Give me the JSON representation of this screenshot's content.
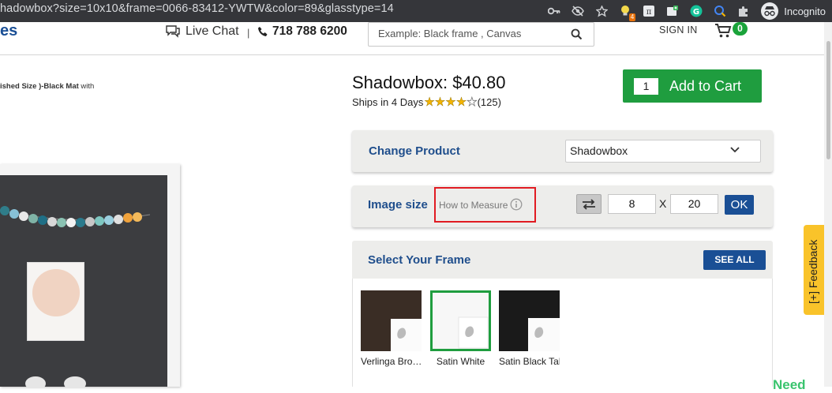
{
  "browser": {
    "url": "hadowbox?size=10x10&frame=0066-83412-YWTW&color=89&glasstype=14",
    "extension_badge": "4",
    "incognito_label": "Incognito"
  },
  "header": {
    "logo_fragment": "es",
    "live_chat": "Live Chat",
    "separator": "|",
    "phone": "718 788 6200",
    "search_placeholder": "Example: Black frame , Canvas",
    "sign_in": "SIGN IN",
    "cart_count": "0"
  },
  "image_caption": {
    "bold": "ished Size )-Black Mat",
    "rest": " with"
  },
  "product": {
    "title": "Shadowbox: $40.80",
    "ships": "Ships in 4 Days",
    "rating_stars": 4,
    "rating_max": 5,
    "review_count": "(125)",
    "qty": "1",
    "add_to_cart": "Add to Cart"
  },
  "change_product": {
    "label": "Change Product",
    "selected": "Shadowbox"
  },
  "image_size": {
    "label": "Image size",
    "how_to": "How to Measure",
    "width": "8",
    "x": "X",
    "height": "20",
    "ok": "OK"
  },
  "select_frame": {
    "label": "Select Your Frame",
    "see_all": "SEE ALL",
    "frames": [
      {
        "name": "Verlinga Bro…",
        "color": "#3a2d25",
        "selected": false
      },
      {
        "name": "Satin White",
        "color": "#f7f7f7",
        "selected": true
      },
      {
        "name": "Satin Black Tall",
        "color": "#1a1a1a",
        "selected": false
      }
    ]
  },
  "feedback": "[+] Feedback",
  "need_help": "Need",
  "colors": {
    "accent_blue": "#1a4f95",
    "cart_green": "#1f9d3f",
    "highlight_red": "#e11b22",
    "feedback_yellow": "#f9c32a"
  }
}
